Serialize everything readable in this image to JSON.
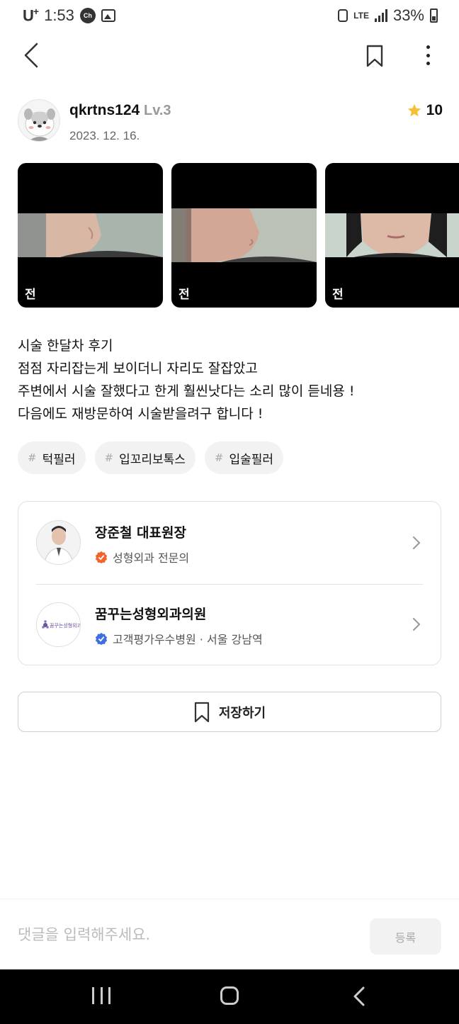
{
  "status_bar": {
    "carrier": "U",
    "carrier_plus": "+",
    "time": "1:53",
    "chat_icon_label": "Ch",
    "network": "LTE",
    "battery_percent": "33%"
  },
  "nav": {
    "back_icon": "chevron-left-icon",
    "bookmark_icon": "bookmark-icon",
    "more_icon": "more-vertical-icon"
  },
  "author": {
    "username": "qkrtns124",
    "level": "Lv.3",
    "date": "2023. 12. 16.",
    "rating": "10"
  },
  "photos": [
    {
      "label": "전"
    },
    {
      "label": "전"
    },
    {
      "label": "전"
    }
  ],
  "post": {
    "lines": [
      "시술 한달차 후기",
      "점점 자리잡는게 보이더니 자리도 잘잡았고",
      "주변에서 시술 잘했다고 한게 훨씬낫다는 소리 많이 듣네용 !",
      "다음에도 재방문하여 시술받을려구 합니다 !"
    ]
  },
  "tags": [
    {
      "hash": "#",
      "label": "턱필러"
    },
    {
      "hash": "#",
      "label": "입꼬리보톡스"
    },
    {
      "hash": "#",
      "label": "입술필러"
    }
  ],
  "doctor": {
    "name": "장준철 대표원장",
    "specialty": "성형외과 전문의",
    "badge_color": "#f0642d"
  },
  "clinic": {
    "name": "꿈꾸는성형외과의원",
    "logo_text": "꿈꾸는성형외과",
    "info": "고객평가우수병원 · 서울 강남역",
    "badge_color": "#3d6fe0"
  },
  "save": {
    "label": "저장하기"
  },
  "comment": {
    "placeholder": "댓글을 입력해주세요.",
    "submit_label": "등록"
  },
  "colors": {
    "star": "#f6c034",
    "tag_bg": "#f2f2f2",
    "text_primary": "#111111"
  }
}
